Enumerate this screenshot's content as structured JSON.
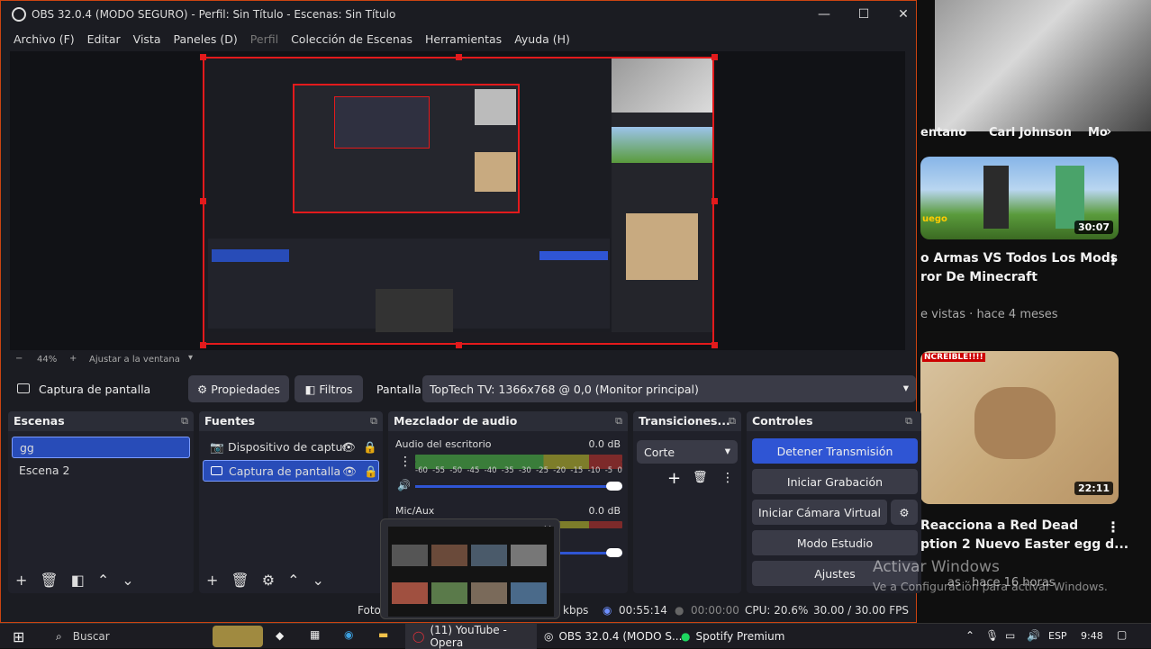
{
  "window": {
    "title": "OBS 32.0.4 (MODO SEGURO) - Perfil: Sin Título - Escenas: Sin Título",
    "minimize": "—",
    "maximize": "☐",
    "close": "✕"
  },
  "menu": {
    "items": [
      "Archivo (F)",
      "Editar",
      "Vista",
      "Paneles (D)",
      "Perfil",
      "Colección de Escenas",
      "Herramientas",
      "Ayuda (H)"
    ]
  },
  "zoom": {
    "minus": "−",
    "level": "44%",
    "plus": "+",
    "fit": "Ajustar a la ventana"
  },
  "source_bar": {
    "source_name": "Captura de pantalla",
    "properties": "Propiedades",
    "filters": "Filtros",
    "display_label": "Pantalla",
    "display_value": "TopTech TV: 1366x768 @ 0,0 (Monitor principal)"
  },
  "scenes": {
    "title": "Escenas",
    "items": [
      "gg",
      "Escena 2"
    ]
  },
  "sources": {
    "title": "Fuentes",
    "items": [
      "Dispositivo de captur",
      "Captura de pantalla"
    ]
  },
  "mixer": {
    "title": "Mezclador de audio",
    "channels": [
      {
        "name": "Audio del escritorio",
        "db": "0.0 dB"
      },
      {
        "name": "Mic/Aux",
        "db": "0.0 dB"
      }
    ],
    "scale": [
      "-60",
      "-55",
      "-50",
      "-45",
      "-40",
      "-35",
      "-30",
      "-25",
      "-20",
      "-15",
      "-10",
      "-5",
      "0"
    ]
  },
  "transitions": {
    "title": "Transiciones...",
    "selected": "Corte"
  },
  "controls": {
    "title": "Controles",
    "stop_stream": "Detener Transmisión",
    "start_recording": "Iniciar Grabación",
    "virtual_camera": "Iniciar Cámara Virtual",
    "studio_mode": "Modo Estudio",
    "settings": "Ajustes"
  },
  "status": {
    "frames": "Fotog",
    "bitrate": "kbps",
    "stream_time": "00:55:14",
    "rec_time": "00:00:00",
    "cpu": "CPU: 20.6%",
    "fps": "30.00 / 30.00 FPS"
  },
  "activate_windows": {
    "title": "Activar Windows",
    "subtitle": "Ve a Configuración para activar Windows."
  },
  "youtube": {
    "chips": [
      "entano",
      "Carl Johnson",
      "Mo"
    ],
    "videos": [
      {
        "title_line1": "o Armas VS Todos Los Mods",
        "title_line2": "ror De Minecraft",
        "meta": "e vistas · hace 4 meses",
        "duration": "30:07",
        "badge": "uego"
      },
      {
        "title_line1": "Reacciona a Red Dead",
        "title_line2": "ption 2 Nuevo Easter egg d...",
        "meta": "as · hace 16 horas",
        "duration": "22:11",
        "badge": "NCREÍBLE!!!!"
      }
    ]
  },
  "taskbar": {
    "search": "Buscar",
    "apps": [
      "(11) YouTube - Opera",
      "OBS 32.0.4 (MODO S...",
      "Spotify Premium"
    ],
    "lang": "ESP",
    "time": "9:48"
  },
  "colors": {
    "accent": "#284cb8",
    "stream_button": "#2f55d4",
    "selection_border": "#e31a1c",
    "panel": "#20212a"
  }
}
